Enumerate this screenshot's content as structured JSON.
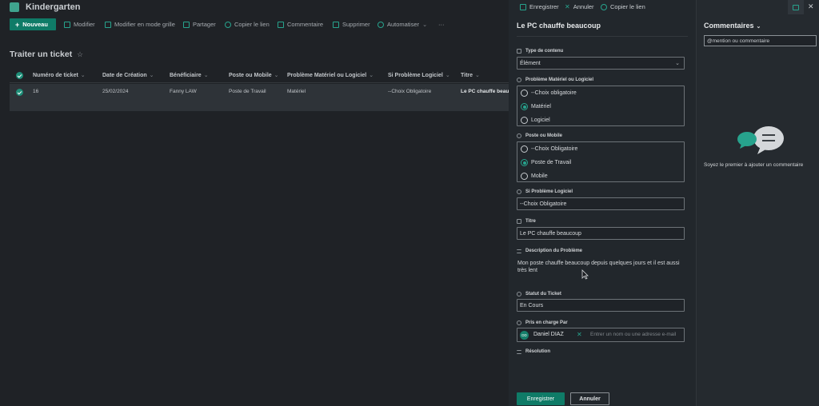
{
  "site": {
    "title": "Kindergarten"
  },
  "commandbar": {
    "new_label": "Nouveau",
    "items": [
      "Modifier",
      "Modifier en mode grille",
      "Partager",
      "Copier le lien",
      "Commentaire",
      "Supprimer",
      "Automatiser",
      "···"
    ]
  },
  "list": {
    "title": "Traiter un ticket",
    "columns": [
      "Numéro de ticket",
      "Date de Création",
      "Bénéficiaire",
      "Poste ou Mobile",
      "Problème Matériel ou Logiciel",
      "Si Problème Logiciel",
      "Titre"
    ],
    "row": {
      "ticket": "16",
      "date": "25/02/2024",
      "beneficiaire": "Fanny LAW",
      "poste": "Poste de Travail",
      "probleme": "Matériel",
      "logiciel": "--Choix Obligatoire",
      "titre": "Le PC chauffe beaucoup"
    }
  },
  "panel": {
    "top": {
      "save": "Enregistrer",
      "cancel": "Annuler",
      "copy": "Copier le lien"
    },
    "title": "Le PC chauffe beaucoup",
    "content_type": {
      "label": "Type de contenu",
      "value": "Élément"
    },
    "hw_sw": {
      "label": "Problème Matériel ou Logiciel",
      "options": [
        "--Choix obligatoire",
        "Matériel",
        "Logiciel"
      ],
      "selected": "Matériel"
    },
    "poste": {
      "label": "Poste ou Mobile",
      "options": [
        "--Choix Obligatoire",
        "Poste de Travail",
        "Mobile"
      ],
      "selected": "Poste de Travail"
    },
    "si_logiciel": {
      "label": "Si Problème Logiciel",
      "value": "--Choix Obligatoire"
    },
    "titre": {
      "label": "Titre",
      "value": "Le PC chauffe beaucoup"
    },
    "description": {
      "label": "Description du Problème",
      "value": "Mon poste chauffe beaucoup depuis quelques jours et il est aussi très lent"
    },
    "statut": {
      "label": "Statut du Ticket",
      "value": "En Cours"
    },
    "pris_en_charge": {
      "label": "Pris en charge Par",
      "person": "Daniel DIAZ",
      "initials": "DD",
      "placeholder": "Entrer un nom ou une adresse e-mail"
    },
    "resolution": {
      "label": "Résolution"
    },
    "buttons": {
      "save": "Enregistrer",
      "cancel": "Annuler"
    }
  },
  "comments": {
    "title": "Commentaires",
    "input_placeholder": "@mention ou commentaire",
    "empty_text": "Soyez le premier à ajouter un commentaire"
  },
  "colors": {
    "accent": "#0f7b67",
    "accent_light": "#27a38d",
    "panel_bg": "#22272c"
  }
}
